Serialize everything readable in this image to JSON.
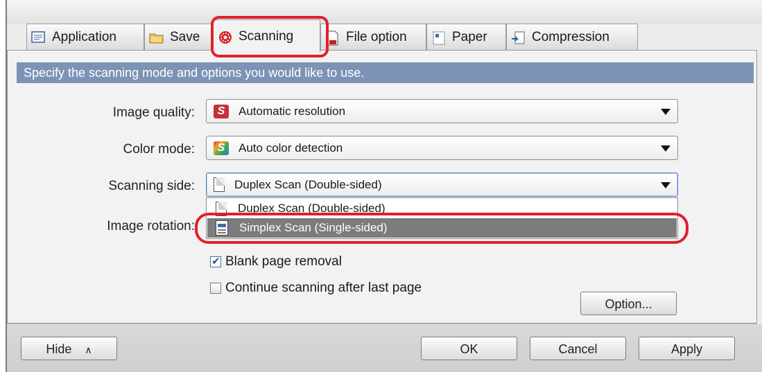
{
  "tabs": [
    {
      "label": "Application",
      "icon": "application-icon"
    },
    {
      "label": "Save",
      "icon": "folder-icon"
    },
    {
      "label": "Scanning",
      "icon": "scanning-icon",
      "active": true
    },
    {
      "label": "File option",
      "icon": "file-option-icon"
    },
    {
      "label": "Paper",
      "icon": "paper-icon"
    },
    {
      "label": "Compression",
      "icon": "compression-icon"
    }
  ],
  "banner": "Specify the scanning mode and options you would like to use.",
  "fields": {
    "image_quality": {
      "label": "Image quality:",
      "value": "Automatic resolution"
    },
    "color_mode": {
      "label": "Color mode:",
      "value": "Auto color detection"
    },
    "scanning_side": {
      "label": "Scanning side:",
      "value": "Duplex Scan (Double-sided)"
    },
    "image_rotation": {
      "label": "Image rotation:"
    }
  },
  "scanning_side_options": [
    "Duplex Scan (Double-sided)",
    "Simplex Scan (Single-sided)"
  ],
  "checks": {
    "blank_page": {
      "label": "Blank page removal",
      "checked": true
    },
    "continue_scan": {
      "label": "Continue scanning after last page",
      "checked": false
    }
  },
  "buttons": {
    "option": "Option...",
    "hide": "Hide",
    "ok": "OK",
    "cancel": "Cancel",
    "apply": "Apply"
  },
  "colors": {
    "banner": "#7d93b5",
    "highlight": "#e0202c",
    "selected_item": "#7c7c7c"
  }
}
